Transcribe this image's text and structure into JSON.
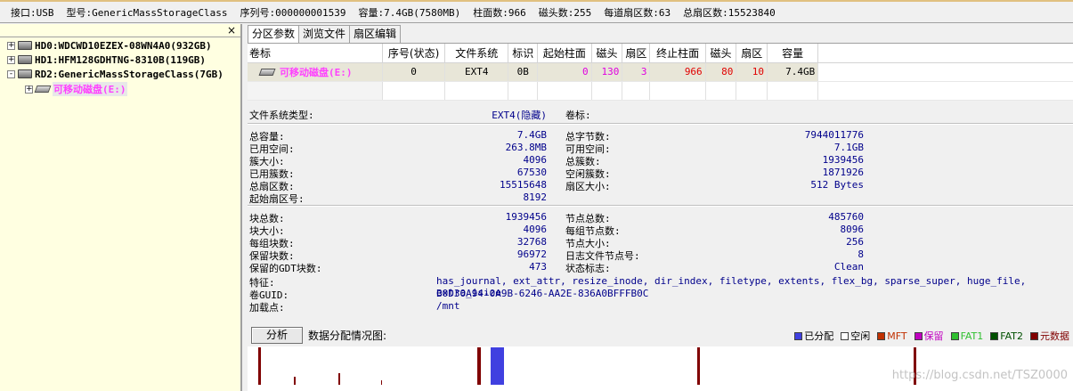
{
  "info_bar": {
    "interface": "接口:USB",
    "model": "型号:GenericMassStorageClass",
    "serial": "序列号:000000001539",
    "capacity": "容量:7.4GB(7580MB)",
    "cylinders": "柱面数:966",
    "heads": "磁头数:255",
    "sectors_per_track": "每道扇区数:63",
    "total_sectors": "总扇区数:15523840"
  },
  "tree": {
    "close_glyph": "×",
    "items": [
      {
        "expander": "+",
        "label": "HD0:WDCWD10EZEX-08WN4A0(932GB)"
      },
      {
        "expander": "+",
        "label": "HD1:HFM128GDHTNG-8310B(119GB)"
      },
      {
        "expander": "-",
        "label": "RD2:GenericMassStorageClass(7GB)"
      },
      {
        "expander": "+",
        "label": "可移动磁盘(E:)"
      }
    ]
  },
  "tabs": [
    "分区参数",
    "浏览文件",
    "扇区编辑"
  ],
  "grid": {
    "headers": [
      "卷标",
      "序号(状态)",
      "文件系统",
      "标识",
      "起始柱面",
      "磁头",
      "扇区",
      "终止柱面",
      "磁头",
      "扇区",
      "容量"
    ],
    "row": {
      "volume": "可移动磁盘(E:)",
      "index": "0",
      "fs": "EXT4",
      "id": "0B",
      "start_cyl": "0",
      "start_head": "130",
      "start_sector": "3",
      "end_cyl": "966",
      "end_head": "80",
      "end_sector": "10",
      "capacity": "7.4GB"
    }
  },
  "details": {
    "fs_type_label": "文件系统类型:",
    "fs_type_value": "EXT4(隐藏)",
    "volume_label_label": "卷标:",
    "left1": [
      {
        "label": "总容量:",
        "value": "7.4GB"
      },
      {
        "label": "已用空间:",
        "value": "263.8MB"
      },
      {
        "label": "簇大小:",
        "value": "4096"
      },
      {
        "label": "已用簇数:",
        "value": "67530"
      },
      {
        "label": "总扇区数:",
        "value": "15515648"
      },
      {
        "label": "起始扇区号:",
        "value": "8192"
      }
    ],
    "right1": [
      {
        "label": "总字节数:",
        "value": "7944011776"
      },
      {
        "label": "可用空间:",
        "value": "7.1GB"
      },
      {
        "label": "总簇数:",
        "value": "1939456"
      },
      {
        "label": "空闲簇数:",
        "value": "1871926"
      },
      {
        "label": "扇区大小:",
        "value": "512 Bytes"
      }
    ],
    "left2": [
      {
        "label": "块总数:",
        "value": "1939456"
      },
      {
        "label": "块大小:",
        "value": "4096"
      },
      {
        "label": "每组块数:",
        "value": "32768"
      },
      {
        "label": "保留块数:",
        "value": "96972"
      },
      {
        "label": "保留的GDT块数:",
        "value": "473"
      }
    ],
    "right2": [
      {
        "label": "节点总数:",
        "value": "485760"
      },
      {
        "label": "每组节点数:",
        "value": "8096"
      },
      {
        "label": "节点大小:",
        "value": "256"
      },
      {
        "label": "日志文件节点号:",
        "value": "8"
      },
      {
        "label": "状态标志:",
        "value": "Clean"
      }
    ],
    "features_label": "特征:",
    "features_value": "has_journal, ext_attr, resize_inode, dir_index, filetype, extents, flex_bg, sparse_super, huge_file, extra_isize",
    "guid_label": "卷GUID:",
    "guid_value": "B0D30A94-0A9B-6246-AA2E-836A0BFFFB0C",
    "mount_label": "加载点:",
    "mount_value": "/mnt"
  },
  "analysis": {
    "button": "分析",
    "label": "数据分配情况图:",
    "legend": [
      {
        "label": "已分配",
        "color": "#4040e0"
      },
      {
        "label": "空闲",
        "color": "#ffffff"
      },
      {
        "label": "MFT",
        "color": "#c03000"
      },
      {
        "label": "保留",
        "color": "#c000c0"
      },
      {
        "label": "FAT1",
        "color": "#30c030"
      },
      {
        "label": "FAT2",
        "color": "#005000"
      },
      {
        "label": "元数据",
        "color": "#800000"
      }
    ]
  },
  "watermark": "https://blog.csdn.net/TSZ0000"
}
